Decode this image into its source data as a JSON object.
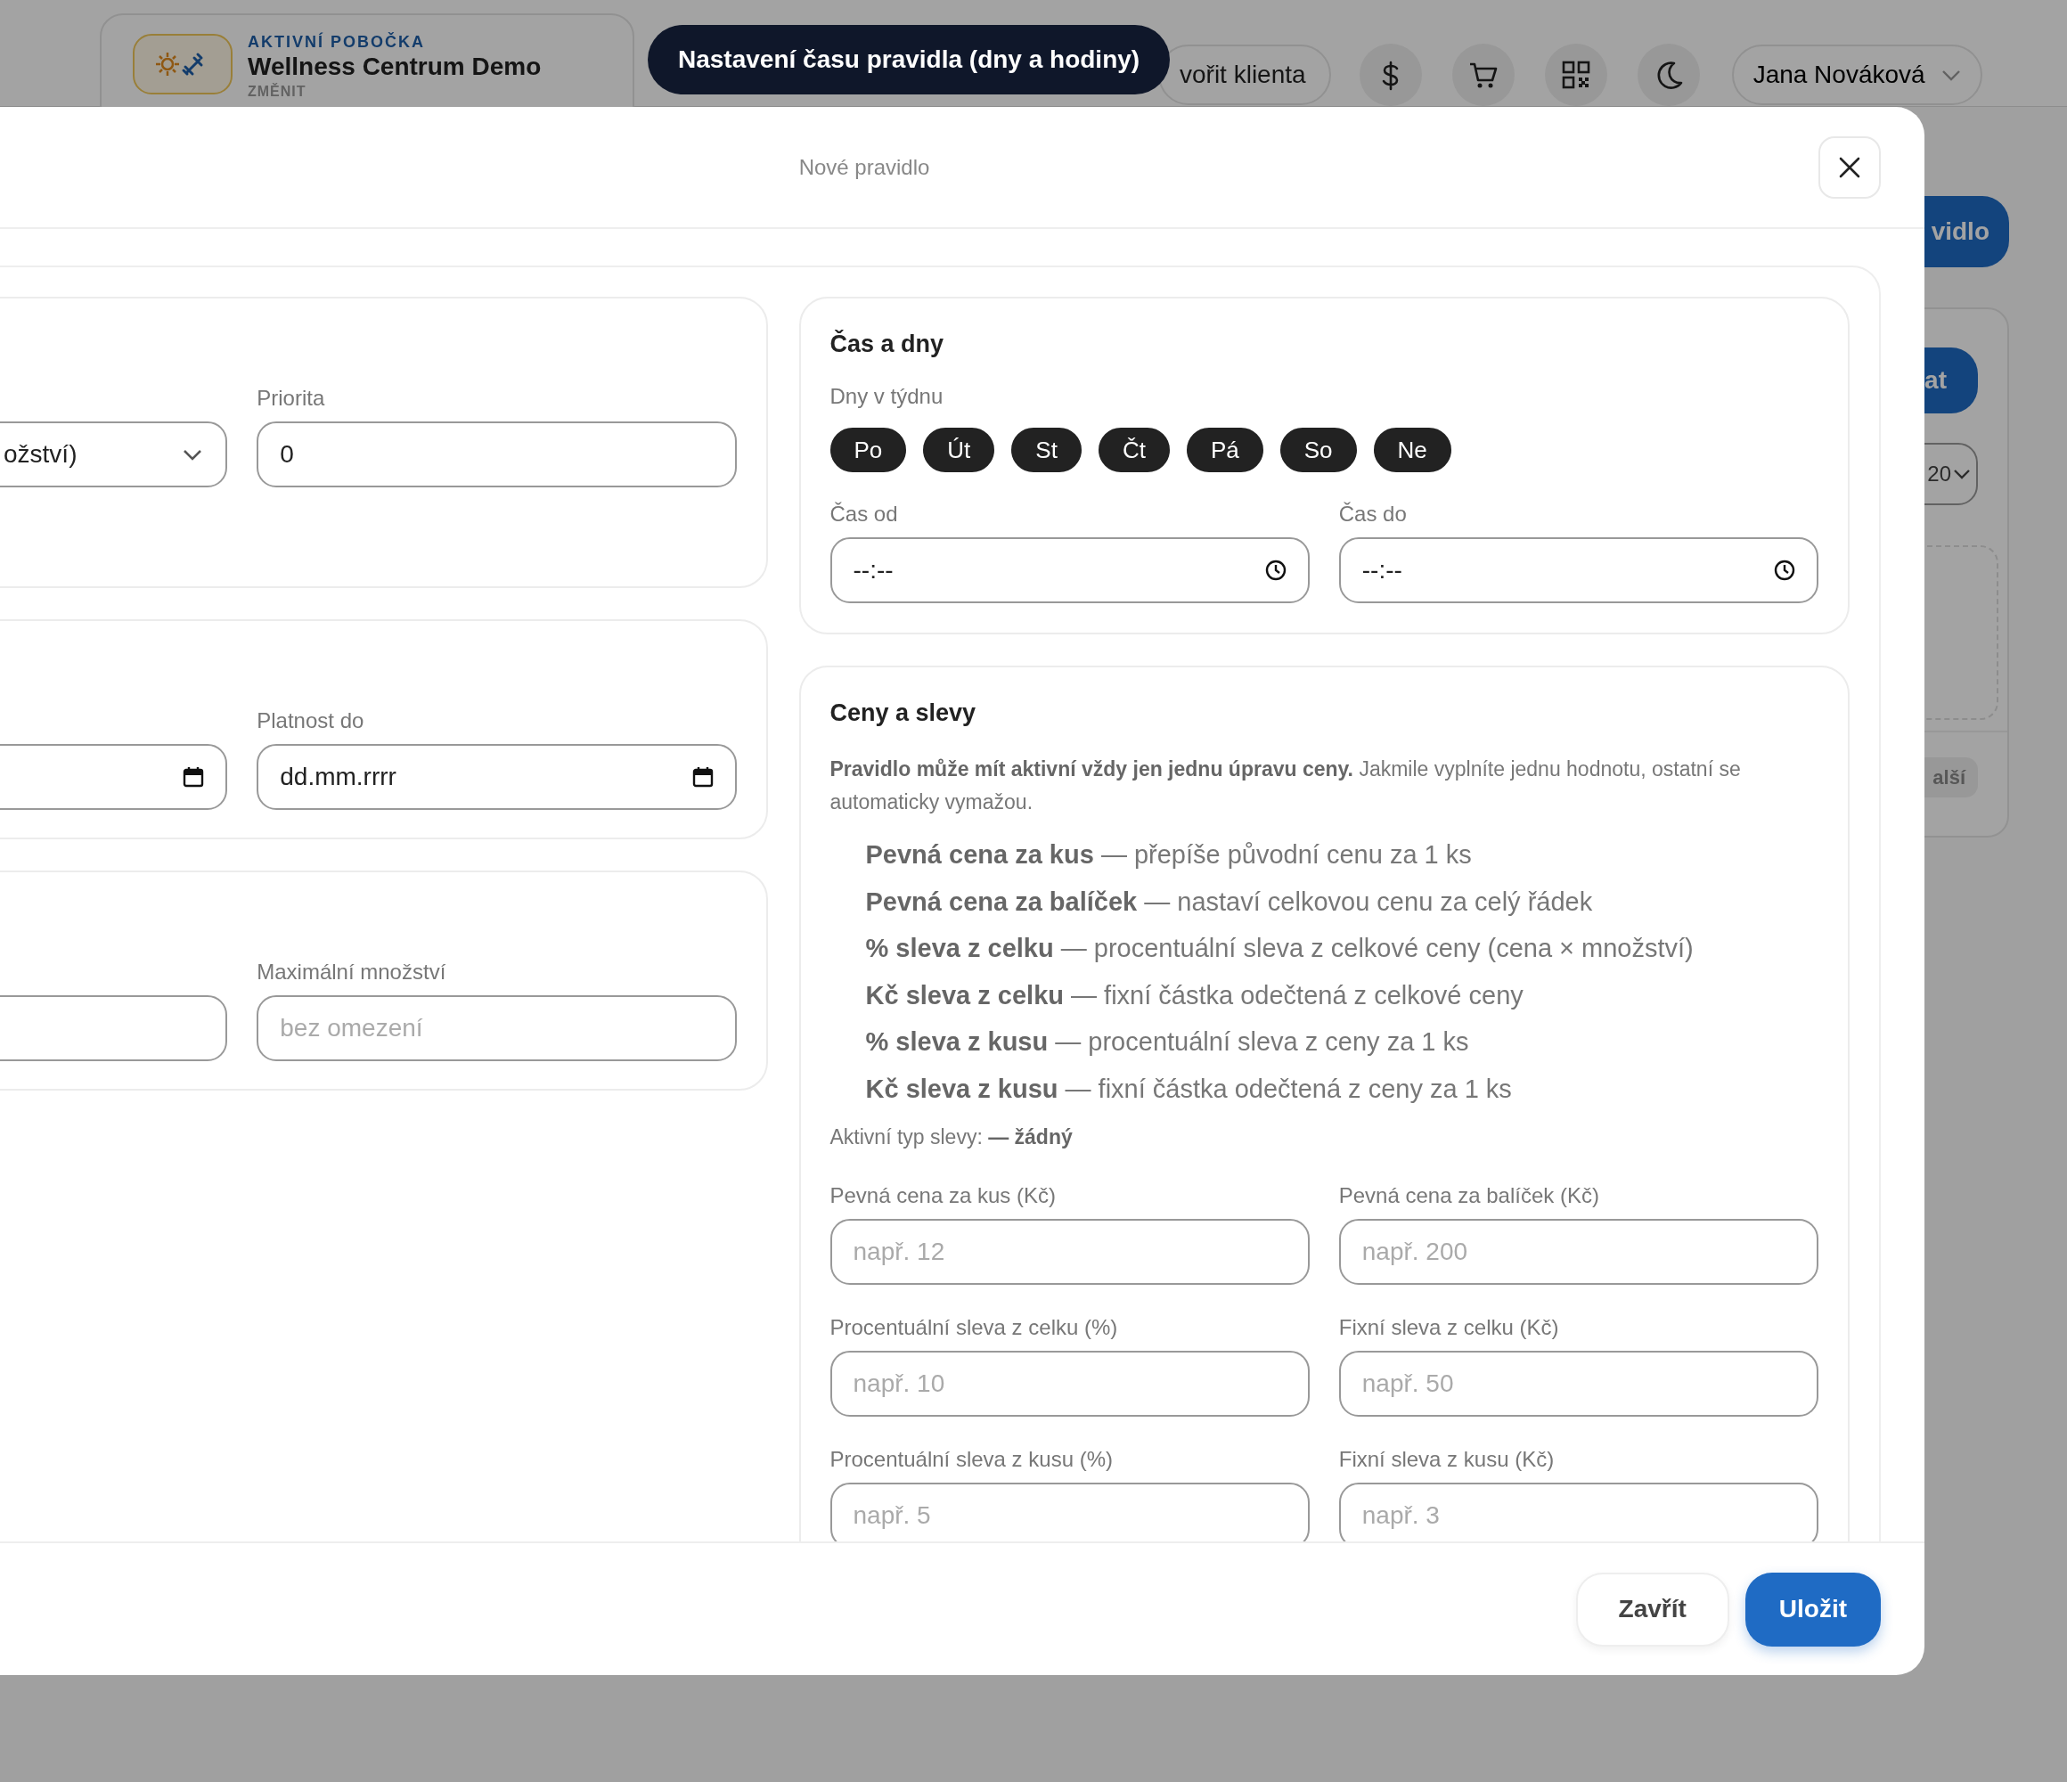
{
  "header": {
    "branch": {
      "label": "AKTIVNÍ POBOČKA",
      "name": "Wellness Centrum Demo",
      "action": "ZMĚNIT"
    },
    "create_client_button": "vořit klienta",
    "user": "Jana Nováková"
  },
  "tooltip": "Nastavení času pravidla (dny a hodiny)",
  "background": {
    "primary_button": "vidlo",
    "card_button": "at",
    "select_value": "20",
    "footer_button": "alší"
  },
  "modal": {
    "title": "Nové pravidlo",
    "left_cards": [
      {
        "fields": [
          {
            "kind": "select",
            "value": "ožství)"
          },
          {
            "kind": "text",
            "label": "Priorita",
            "value": "0"
          }
        ]
      },
      {
        "fields": [
          {
            "kind": "date"
          },
          {
            "kind": "date",
            "label": "Platnost do",
            "value": "dd.mm.rrrr"
          }
        ]
      },
      {
        "fields": [
          {
            "kind": "text"
          },
          {
            "kind": "text",
            "label": "Maximální množství",
            "placeholder": "bez omezení"
          }
        ]
      }
    ],
    "time_card": {
      "title": "Čas a dny",
      "days_label": "Dny v týdnu",
      "days": [
        {
          "label": "Po",
          "selected": true
        },
        {
          "label": "Út",
          "selected": true
        },
        {
          "label": "St",
          "selected": true
        },
        {
          "label": "Čt",
          "selected": true
        },
        {
          "label": "Pá",
          "selected": true
        },
        {
          "label": "So",
          "selected": true
        },
        {
          "label": "Ne",
          "selected": true
        }
      ],
      "time_fields": [
        {
          "label": "Čas od",
          "value": "--:--"
        },
        {
          "label": "Čas do",
          "value": "--:--"
        }
      ]
    },
    "price_card": {
      "title": "Ceny a slevy",
      "note": "**Pravidlo může mít aktivní vždy jen jednu úpravu ceny.** Jakmile vyplníte jednu hodnotu, ostatní se automaticky vymažou.",
      "options": [
        "**Pevná cena za kus** — přepíše původní cenu za 1 ks",
        "**Pevná cena za balíček** — nastaví celkovou cenu za celý řádek",
        "**% sleva z celku** — procentuální sleva z celkové ceny (cena × množství)",
        "**Kč sleva z celku** — fixní částka odečtená z celkové ceny",
        "**% sleva z kusu** — procentuální sleva z ceny za 1 ks",
        "**Kč sleva z kusu** — fixní částka odečtená z ceny za 1 ks"
      ],
      "active_type": "Aktivní typ slevy: **— žádný**",
      "fields": [
        {
          "label": "Pevná cena za kus (Kč)",
          "placeholder": "např. 12"
        },
        {
          "label": "Pevná cena za balíček (Kč)",
          "placeholder": "např. 200"
        },
        {
          "label": "Procentuální sleva z celku (%)",
          "placeholder": "např. 10"
        },
        {
          "label": "Fixní sleva z celku (Kč)",
          "placeholder": "např. 50"
        },
        {
          "label": "Procentuální sleva z kusu (%)",
          "placeholder": "např. 5"
        },
        {
          "label": "Fixní sleva z kusu (Kč)",
          "placeholder": "např. 3"
        }
      ]
    },
    "buttons": [
      {
        "label": "Zavřít",
        "kind": "secondary"
      },
      {
        "label": "Uložit",
        "kind": "primary"
      }
    ]
  }
}
